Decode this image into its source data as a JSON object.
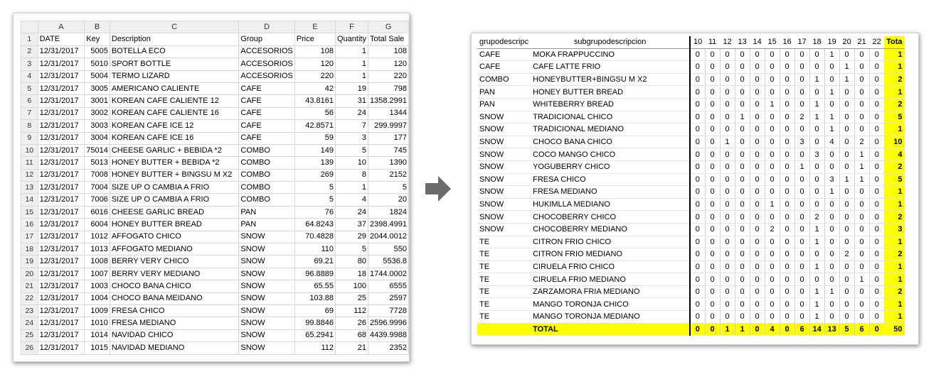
{
  "left_sheet": {
    "col_letters": [
      "A",
      "B",
      "C",
      "D",
      "E",
      "F",
      "G"
    ],
    "headers": [
      "DATE",
      "Key",
      "Description",
      "Group",
      "Price",
      "Quantity",
      "Total Sale"
    ],
    "rows": [
      [
        "12/31/2017",
        "5005",
        "BOTELLA ECO",
        "ACCESORIOS",
        "108",
        "1",
        "108"
      ],
      [
        "12/31/2017",
        "5010",
        "SPORT BOTTLE",
        "ACCESORIOS",
        "120",
        "1",
        "120"
      ],
      [
        "12/31/2017",
        "5004",
        "TERMO LIZARD",
        "ACCESORIOS",
        "220",
        "1",
        "220"
      ],
      [
        "12/31/2017",
        "3005",
        "AMERICANO CALIENTE",
        "CAFE",
        "42",
        "19",
        "798"
      ],
      [
        "12/31/2017",
        "3001",
        "KOREAN CAFE CALIENTE 12",
        "CAFE",
        "43.8161",
        "31",
        "1358.2991"
      ],
      [
        "12/31/2017",
        "3002",
        "KOREAN CAFE CALIENTE 16",
        "CAFE",
        "56",
        "24",
        "1344"
      ],
      [
        "12/31/2017",
        "3003",
        "KOREAN CAFE ICE 12",
        "CAFE",
        "42.8571",
        "7",
        "299.9997"
      ],
      [
        "12/31/2017",
        "3004",
        "KOREAN CAFE ICE 16",
        "CAFE",
        "59",
        "3",
        "177"
      ],
      [
        "12/31/2017",
        "75014",
        "CHEESE GARLIC + BEBIDA *2",
        "COMBO",
        "149",
        "5",
        "745"
      ],
      [
        "12/31/2017",
        "5013",
        "HONEY BUTTER + BEBIDA *2",
        "COMBO",
        "139",
        "10",
        "1390"
      ],
      [
        "12/31/2017",
        "7008",
        "HONEY BUTTER + BINGSU M X2",
        "COMBO",
        "269",
        "8",
        "2152"
      ],
      [
        "12/31/2017",
        "7004",
        "SIZE UP O CAMBIA A FRIO",
        "COMBO",
        "5",
        "1",
        "5"
      ],
      [
        "12/31/2017",
        "7006",
        "SIZE UP O CAMBIA A FRIO",
        "COMBO",
        "5",
        "4",
        "20"
      ],
      [
        "12/31/2017",
        "6016",
        "CHEESE GARLIC BREAD",
        "PAN",
        "76",
        "24",
        "1824"
      ],
      [
        "12/31/2017",
        "6004",
        "HONEY BUTTER BREAD",
        "PAN",
        "64.8243",
        "37",
        "2398.4991"
      ],
      [
        "12/31/2017",
        "1012",
        "AFFOGATO CHICO",
        "SNOW",
        "70.4828",
        "29",
        "2044.0012"
      ],
      [
        "12/31/2017",
        "1013",
        "AFFOGATO MEDIANO",
        "SNOW",
        "110",
        "5",
        "550"
      ],
      [
        "12/31/2017",
        "1008",
        "BERRY VERY CHICO",
        "SNOW",
        "69.21",
        "80",
        "5536.8"
      ],
      [
        "12/31/2017",
        "1007",
        "BERRY VERY MEDIANO",
        "SNOW",
        "96.8889",
        "18",
        "1744.0002"
      ],
      [
        "12/31/2017",
        "1003",
        "CHOCO BANA CHICO",
        "SNOW",
        "65.55",
        "100",
        "6555"
      ],
      [
        "12/31/2017",
        "1004",
        "CHOCO BANA MEIDANO",
        "SNOW",
        "103.88",
        "25",
        "2597"
      ],
      [
        "12/31/2017",
        "1009",
        "FRESA CHICO",
        "SNOW",
        "69",
        "112",
        "7728"
      ],
      [
        "12/31/2017",
        "1010",
        "FRESA MEDIANO",
        "SNOW",
        "99.8846",
        "26",
        "2596.9996"
      ],
      [
        "12/31/2017",
        "1014",
        "NAVIDAD  CHICO",
        "SNOW",
        "65.2941",
        "68",
        "4439.9988"
      ],
      [
        "12/31/2017",
        "1015",
        "NAVIDAD MEDIANO",
        "SNOW",
        "112",
        "21",
        "2352"
      ]
    ]
  },
  "right_sheet": {
    "header_group": "grupodescripc",
    "header_sub": "subgrupodescripcion",
    "hours": [
      "10",
      "11",
      "12",
      "13",
      "14",
      "15",
      "16",
      "17",
      "18",
      "19",
      "20",
      "21",
      "22"
    ],
    "total_header": "Tota",
    "rows": [
      {
        "g": "CAFE",
        "s": "MOKA FRAPPUCCINO",
        "v": [
          "0",
          "0",
          "0",
          "0",
          "0",
          "0",
          "0",
          "0",
          "0",
          "1",
          "0",
          "0",
          "0"
        ],
        "t": "1"
      },
      {
        "g": "CAFE",
        "s": "CAFE LATTE FRIO",
        "v": [
          "0",
          "0",
          "0",
          "0",
          "0",
          "0",
          "0",
          "0",
          "0",
          "0",
          "1",
          "0",
          "0"
        ],
        "t": "1"
      },
      {
        "g": "COMBO",
        "s": "HONEYBUTTER+BINGSU M X2",
        "v": [
          "0",
          "0",
          "0",
          "0",
          "0",
          "0",
          "0",
          "0",
          "1",
          "0",
          "1",
          "0",
          "0"
        ],
        "t": "2"
      },
      {
        "g": "PAN",
        "s": "HONEY BUTTER BREAD",
        "v": [
          "0",
          "0",
          "0",
          "0",
          "0",
          "0",
          "0",
          "0",
          "0",
          "1",
          "0",
          "0",
          "0"
        ],
        "t": "1"
      },
      {
        "g": "PAN",
        "s": "WHITEBERRY BREAD",
        "v": [
          "0",
          "0",
          "0",
          "0",
          "0",
          "1",
          "0",
          "0",
          "1",
          "0",
          "0",
          "0",
          "0"
        ],
        "t": "2"
      },
      {
        "g": "SNOW",
        "s": "TRADICIONAL CHICO",
        "v": [
          "0",
          "0",
          "0",
          "1",
          "0",
          "0",
          "0",
          "2",
          "1",
          "1",
          "0",
          "0",
          "0"
        ],
        "t": "5"
      },
      {
        "g": "SNOW",
        "s": "TRADICIONAL MEDIANO",
        "v": [
          "0",
          "0",
          "0",
          "0",
          "0",
          "0",
          "0",
          "0",
          "0",
          "1",
          "0",
          "0",
          "0"
        ],
        "t": "1"
      },
      {
        "g": "SNOW",
        "s": "CHOCO BANA CHICO",
        "v": [
          "0",
          "0",
          "1",
          "0",
          "0",
          "0",
          "0",
          "3",
          "0",
          "4",
          "0",
          "2",
          "0"
        ],
        "t": "10"
      },
      {
        "g": "SNOW",
        "s": "COCO MANGO CHICO",
        "v": [
          "0",
          "0",
          "0",
          "0",
          "0",
          "0",
          "0",
          "0",
          "3",
          "0",
          "0",
          "1",
          "0"
        ],
        "t": "4"
      },
      {
        "g": "SNOW",
        "s": "YOGUBERRY CHICO",
        "v": [
          "0",
          "0",
          "0",
          "0",
          "0",
          "0",
          "0",
          "1",
          "0",
          "0",
          "0",
          "1",
          "0"
        ],
        "t": "2"
      },
      {
        "g": "SNOW",
        "s": "FRESA CHICO",
        "v": [
          "0",
          "0",
          "0",
          "0",
          "0",
          "0",
          "0",
          "0",
          "0",
          "3",
          "1",
          "1",
          "0"
        ],
        "t": "5"
      },
      {
        "g": "SNOW",
        "s": "FRESA MEDIANO",
        "v": [
          "0",
          "0",
          "0",
          "0",
          "0",
          "0",
          "0",
          "0",
          "0",
          "1",
          "0",
          "0",
          "0"
        ],
        "t": "1"
      },
      {
        "g": "SNOW",
        "s": "HUKIMLLA MEDIANO",
        "v": [
          "0",
          "0",
          "0",
          "0",
          "0",
          "1",
          "0",
          "0",
          "0",
          "0",
          "0",
          "0",
          "0"
        ],
        "t": "1"
      },
      {
        "g": "SNOW",
        "s": "CHOCOBERRY CHICO",
        "v": [
          "0",
          "0",
          "0",
          "0",
          "0",
          "0",
          "0",
          "0",
          "2",
          "0",
          "0",
          "0",
          "0"
        ],
        "t": "2"
      },
      {
        "g": "SNOW",
        "s": "CHOCOBERRY MEDIANO",
        "v": [
          "0",
          "0",
          "0",
          "0",
          "0",
          "2",
          "0",
          "0",
          "1",
          "0",
          "0",
          "0",
          "0"
        ],
        "t": "3"
      },
      {
        "g": "TE",
        "s": "CITRON FRIO CHICO",
        "v": [
          "0",
          "0",
          "0",
          "0",
          "0",
          "0",
          "0",
          "0",
          "1",
          "0",
          "0",
          "0",
          "0"
        ],
        "t": "1"
      },
      {
        "g": "TE",
        "s": "CITRON FRIO MEDIANO",
        "v": [
          "0",
          "0",
          "0",
          "0",
          "0",
          "0",
          "0",
          "0",
          "0",
          "0",
          "2",
          "0",
          "0"
        ],
        "t": "2"
      },
      {
        "g": "TE",
        "s": "CIRUELA FRIO CHICO",
        "v": [
          "0",
          "0",
          "0",
          "0",
          "0",
          "0",
          "0",
          "0",
          "1",
          "0",
          "0",
          "0",
          "0"
        ],
        "t": "1"
      },
      {
        "g": "TE",
        "s": "CIRUELA FRIO MEDIANO",
        "v": [
          "0",
          "0",
          "0",
          "0",
          "0",
          "0",
          "0",
          "0",
          "0",
          "0",
          "0",
          "1",
          "0"
        ],
        "t": "1"
      },
      {
        "g": "TE",
        "s": "ZARZAMORA  FRIA MEDIANO",
        "v": [
          "0",
          "0",
          "0",
          "0",
          "0",
          "0",
          "0",
          "0",
          "1",
          "1",
          "0",
          "0",
          "0"
        ],
        "t": "2"
      },
      {
        "g": "TE",
        "s": "MANGO TORONJA CHICO",
        "v": [
          "0",
          "0",
          "0",
          "0",
          "0",
          "0",
          "0",
          "0",
          "1",
          "0",
          "0",
          "0",
          "0"
        ],
        "t": "1"
      },
      {
        "g": "TE",
        "s": "MANGO TORONJA MEDIANO",
        "v": [
          "0",
          "0",
          "0",
          "0",
          "0",
          "0",
          "0",
          "0",
          "1",
          "0",
          "0",
          "0",
          "0"
        ],
        "t": "1"
      }
    ],
    "total_label": "TOTAL",
    "total_values": [
      "0",
      "0",
      "1",
      "1",
      "0",
      "4",
      "0",
      "6",
      "14",
      "13",
      "5",
      "6",
      "0"
    ],
    "grand_total": "50"
  },
  "colors": {
    "highlight": "#ffff00",
    "arrow": "#666666"
  },
  "arrow_icon": "arrow-right-icon"
}
